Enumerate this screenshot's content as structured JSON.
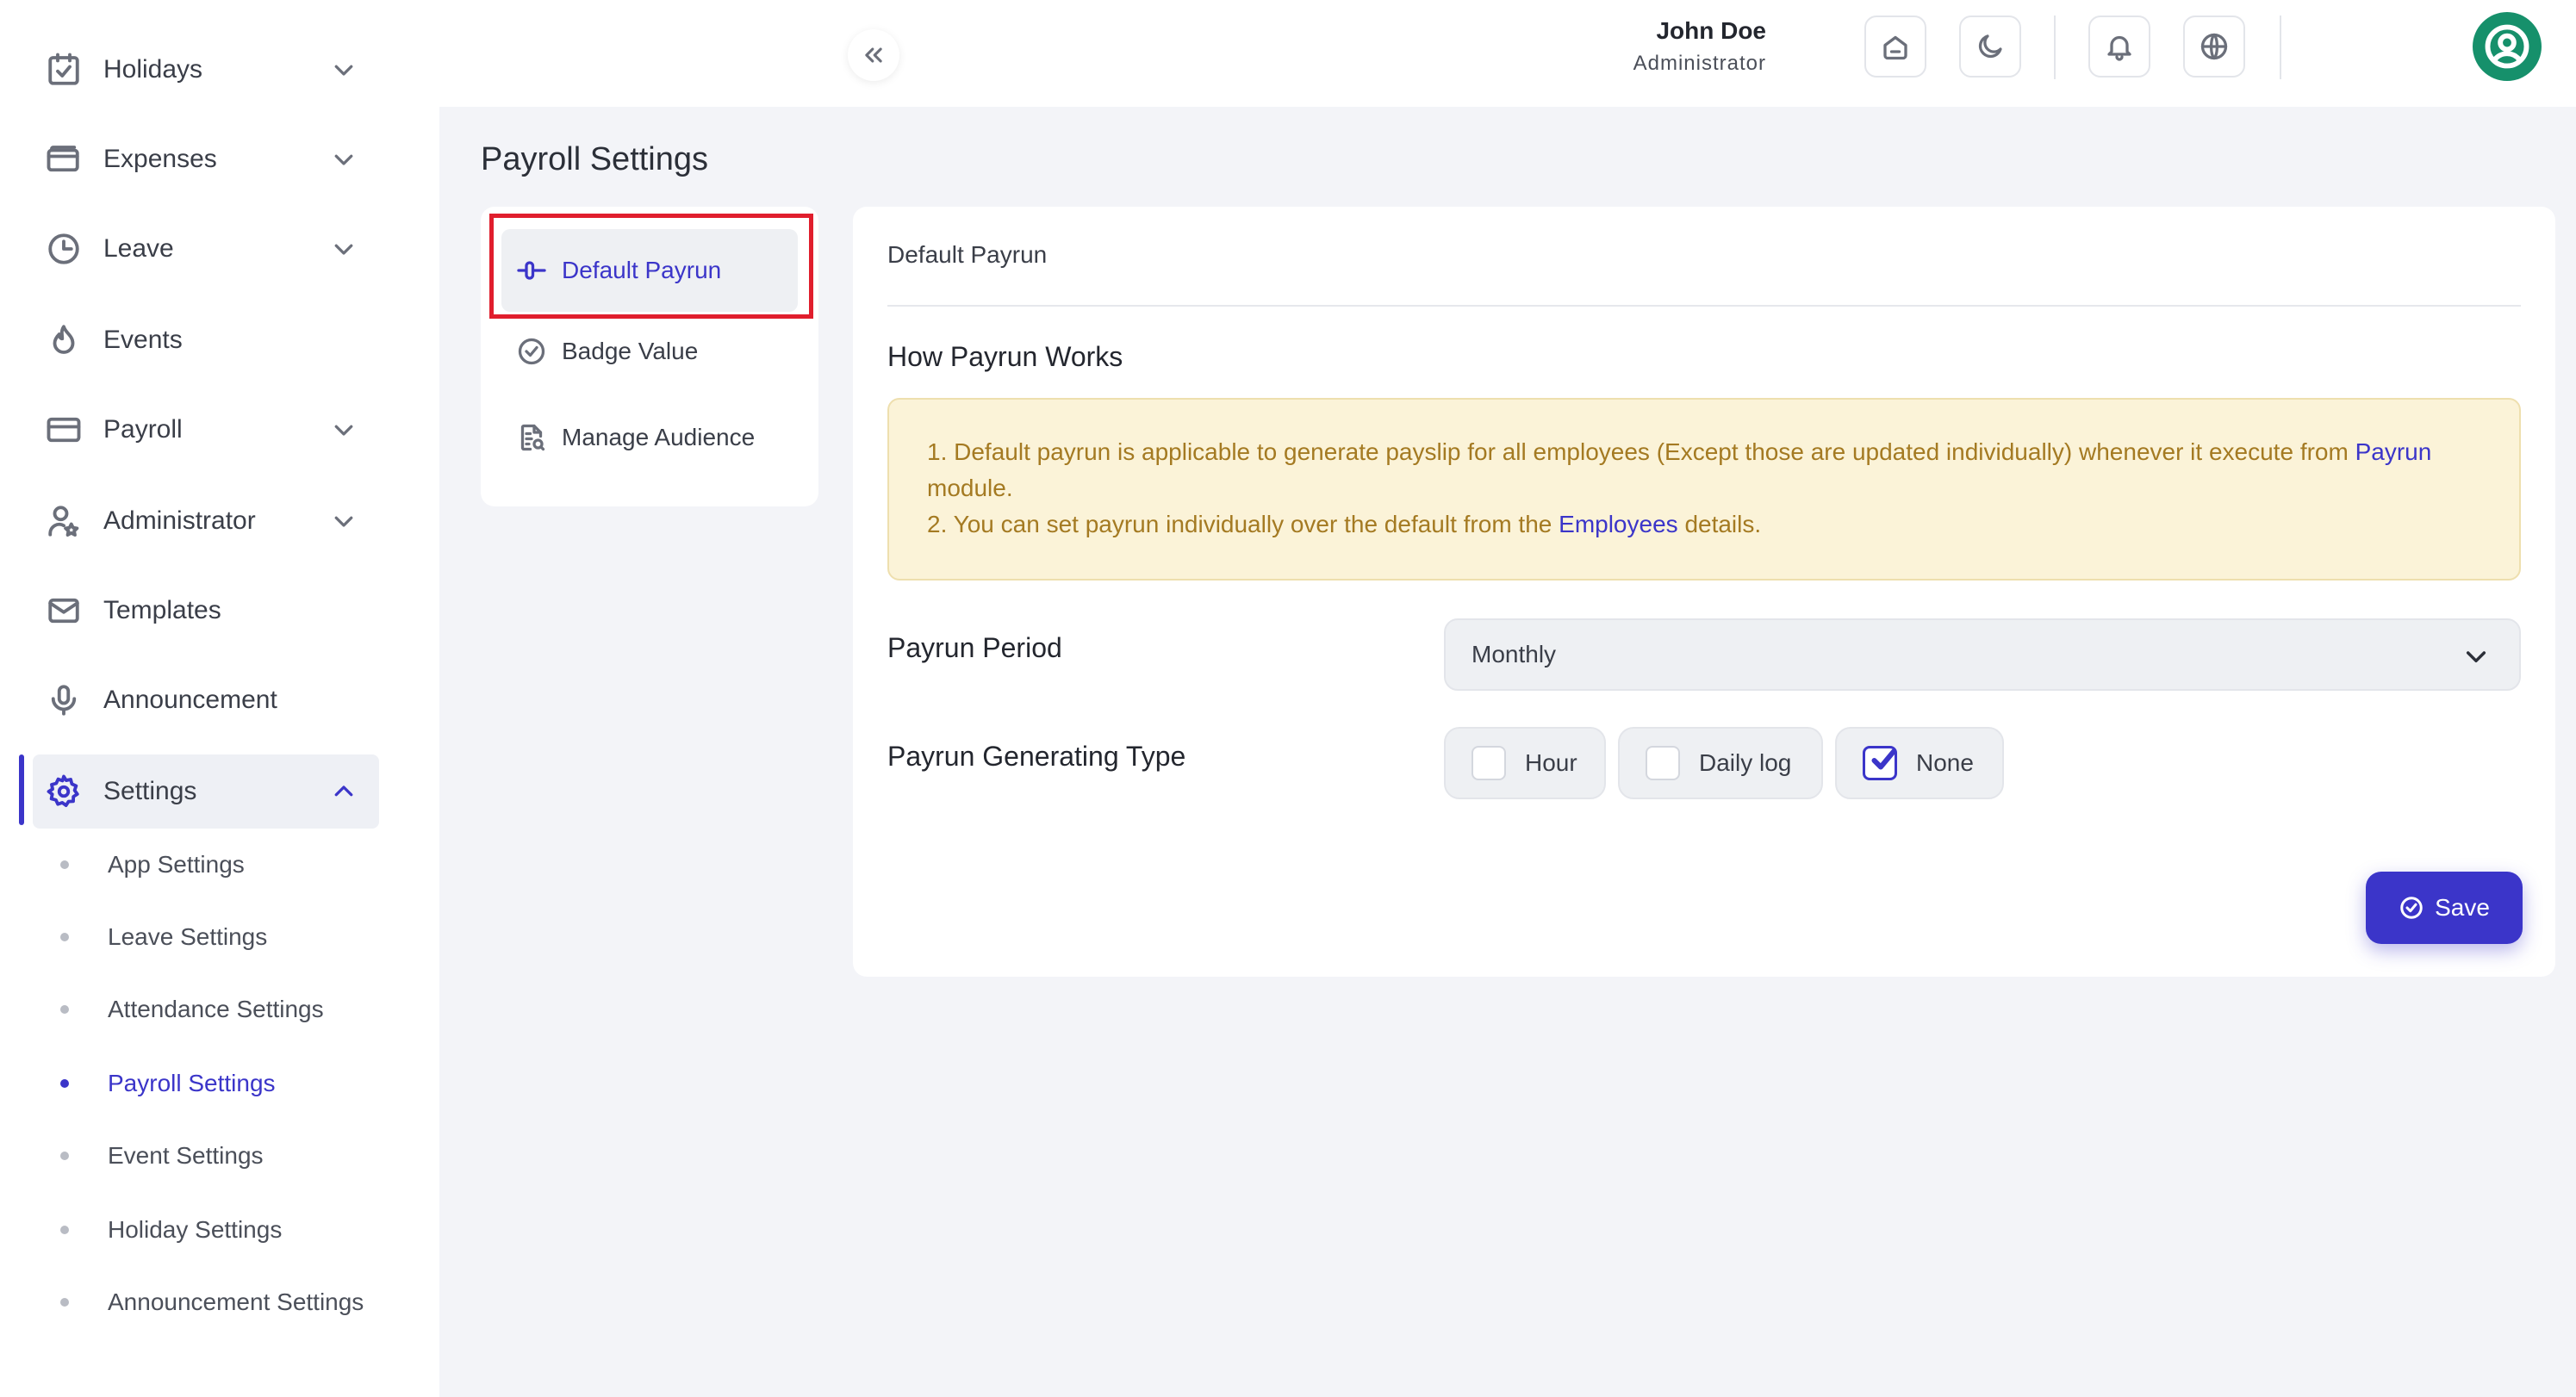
{
  "sidebar": {
    "items": [
      {
        "label": "Holidays",
        "icon": "calendar-check-icon"
      },
      {
        "label": "Expenses",
        "icon": "wallet-icon"
      },
      {
        "label": "Leave",
        "icon": "clock-icon"
      },
      {
        "label": "Events",
        "icon": "flame-icon"
      },
      {
        "label": "Payroll",
        "icon": "credit-card-icon"
      },
      {
        "label": "Administrator",
        "icon": "user-star-icon"
      },
      {
        "label": "Templates",
        "icon": "mail-icon"
      },
      {
        "label": "Announcement",
        "icon": "microphone-icon"
      },
      {
        "label": "Settings",
        "icon": "gear-icon"
      }
    ],
    "settings_sub": [
      {
        "label": "App Settings"
      },
      {
        "label": "Leave Settings"
      },
      {
        "label": "Attendance Settings"
      },
      {
        "label": "Payroll Settings"
      },
      {
        "label": "Event Settings"
      },
      {
        "label": "Holiday Settings"
      },
      {
        "label": "Announcement Settings"
      }
    ],
    "active_item": "Settings",
    "active_sub": "Payroll Settings"
  },
  "user": {
    "name": "John Doe",
    "role": "Administrator"
  },
  "page": {
    "title": "Payroll Settings"
  },
  "subnav": {
    "items": [
      {
        "label": "Default Payrun",
        "icon": "payrun-icon"
      },
      {
        "label": "Badge Value",
        "icon": "check-circle-icon"
      },
      {
        "label": "Manage Audience",
        "icon": "document-search-icon"
      }
    ],
    "selected": "Default Payrun"
  },
  "card": {
    "header": "Default Payrun",
    "section_title": "How Payrun Works",
    "notice": {
      "line1_prefix": "1. Default payrun is applicable to generate payslip for all employees (Except those are updated individually) whenever it execute from",
      "line1_link": "Payrun",
      "line1_suffix": "module.",
      "line2_prefix": "2. You can set payrun individually over the default from the",
      "line2_link": "Employees",
      "line2_suffix": "details."
    },
    "payrun_period": {
      "label": "Payrun Period",
      "value": "Monthly"
    },
    "generating_type": {
      "label": "Payrun Generating Type",
      "options": [
        {
          "label": "Hour",
          "checked": false
        },
        {
          "label": "Daily log",
          "checked": false
        },
        {
          "label": "None",
          "checked": true
        }
      ]
    },
    "save_label": "Save"
  },
  "colors": {
    "accent": "#3b35c9",
    "notice_bg": "#fbf3d8",
    "notice_text": "#a47a22",
    "avatar": "#16906b",
    "highlight": "#e01e2d"
  }
}
